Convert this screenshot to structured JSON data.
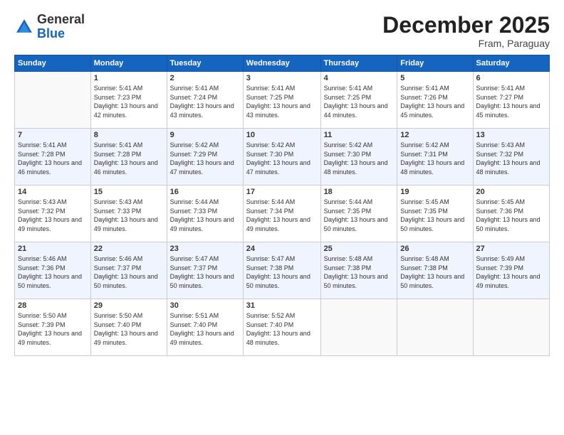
{
  "logo": {
    "general": "General",
    "blue": "Blue"
  },
  "title": "December 2025",
  "location": "Fram, Paraguay",
  "days_header": [
    "Sunday",
    "Monday",
    "Tuesday",
    "Wednesday",
    "Thursday",
    "Friday",
    "Saturday"
  ],
  "weeks": [
    [
      {
        "num": "",
        "sunrise": "",
        "sunset": "",
        "daylight": ""
      },
      {
        "num": "1",
        "sunrise": "Sunrise: 5:41 AM",
        "sunset": "Sunset: 7:23 PM",
        "daylight": "Daylight: 13 hours and 42 minutes."
      },
      {
        "num": "2",
        "sunrise": "Sunrise: 5:41 AM",
        "sunset": "Sunset: 7:24 PM",
        "daylight": "Daylight: 13 hours and 43 minutes."
      },
      {
        "num": "3",
        "sunrise": "Sunrise: 5:41 AM",
        "sunset": "Sunset: 7:25 PM",
        "daylight": "Daylight: 13 hours and 43 minutes."
      },
      {
        "num": "4",
        "sunrise": "Sunrise: 5:41 AM",
        "sunset": "Sunset: 7:25 PM",
        "daylight": "Daylight: 13 hours and 44 minutes."
      },
      {
        "num": "5",
        "sunrise": "Sunrise: 5:41 AM",
        "sunset": "Sunset: 7:26 PM",
        "daylight": "Daylight: 13 hours and 45 minutes."
      },
      {
        "num": "6",
        "sunrise": "Sunrise: 5:41 AM",
        "sunset": "Sunset: 7:27 PM",
        "daylight": "Daylight: 13 hours and 45 minutes."
      }
    ],
    [
      {
        "num": "7",
        "sunrise": "Sunrise: 5:41 AM",
        "sunset": "Sunset: 7:28 PM",
        "daylight": "Daylight: 13 hours and 46 minutes."
      },
      {
        "num": "8",
        "sunrise": "Sunrise: 5:41 AM",
        "sunset": "Sunset: 7:28 PM",
        "daylight": "Daylight: 13 hours and 46 minutes."
      },
      {
        "num": "9",
        "sunrise": "Sunrise: 5:42 AM",
        "sunset": "Sunset: 7:29 PM",
        "daylight": "Daylight: 13 hours and 47 minutes."
      },
      {
        "num": "10",
        "sunrise": "Sunrise: 5:42 AM",
        "sunset": "Sunset: 7:30 PM",
        "daylight": "Daylight: 13 hours and 47 minutes."
      },
      {
        "num": "11",
        "sunrise": "Sunrise: 5:42 AM",
        "sunset": "Sunset: 7:30 PM",
        "daylight": "Daylight: 13 hours and 48 minutes."
      },
      {
        "num": "12",
        "sunrise": "Sunrise: 5:42 AM",
        "sunset": "Sunset: 7:31 PM",
        "daylight": "Daylight: 13 hours and 48 minutes."
      },
      {
        "num": "13",
        "sunrise": "Sunrise: 5:43 AM",
        "sunset": "Sunset: 7:32 PM",
        "daylight": "Daylight: 13 hours and 48 minutes."
      }
    ],
    [
      {
        "num": "14",
        "sunrise": "Sunrise: 5:43 AM",
        "sunset": "Sunset: 7:32 PM",
        "daylight": "Daylight: 13 hours and 49 minutes."
      },
      {
        "num": "15",
        "sunrise": "Sunrise: 5:43 AM",
        "sunset": "Sunset: 7:33 PM",
        "daylight": "Daylight: 13 hours and 49 minutes."
      },
      {
        "num": "16",
        "sunrise": "Sunrise: 5:44 AM",
        "sunset": "Sunset: 7:33 PM",
        "daylight": "Daylight: 13 hours and 49 minutes."
      },
      {
        "num": "17",
        "sunrise": "Sunrise: 5:44 AM",
        "sunset": "Sunset: 7:34 PM",
        "daylight": "Daylight: 13 hours and 49 minutes."
      },
      {
        "num": "18",
        "sunrise": "Sunrise: 5:44 AM",
        "sunset": "Sunset: 7:35 PM",
        "daylight": "Daylight: 13 hours and 50 minutes."
      },
      {
        "num": "19",
        "sunrise": "Sunrise: 5:45 AM",
        "sunset": "Sunset: 7:35 PM",
        "daylight": "Daylight: 13 hours and 50 minutes."
      },
      {
        "num": "20",
        "sunrise": "Sunrise: 5:45 AM",
        "sunset": "Sunset: 7:36 PM",
        "daylight": "Daylight: 13 hours and 50 minutes."
      }
    ],
    [
      {
        "num": "21",
        "sunrise": "Sunrise: 5:46 AM",
        "sunset": "Sunset: 7:36 PM",
        "daylight": "Daylight: 13 hours and 50 minutes."
      },
      {
        "num": "22",
        "sunrise": "Sunrise: 5:46 AM",
        "sunset": "Sunset: 7:37 PM",
        "daylight": "Daylight: 13 hours and 50 minutes."
      },
      {
        "num": "23",
        "sunrise": "Sunrise: 5:47 AM",
        "sunset": "Sunset: 7:37 PM",
        "daylight": "Daylight: 13 hours and 50 minutes."
      },
      {
        "num": "24",
        "sunrise": "Sunrise: 5:47 AM",
        "sunset": "Sunset: 7:38 PM",
        "daylight": "Daylight: 13 hours and 50 minutes."
      },
      {
        "num": "25",
        "sunrise": "Sunrise: 5:48 AM",
        "sunset": "Sunset: 7:38 PM",
        "daylight": "Daylight: 13 hours and 50 minutes."
      },
      {
        "num": "26",
        "sunrise": "Sunrise: 5:48 AM",
        "sunset": "Sunset: 7:38 PM",
        "daylight": "Daylight: 13 hours and 50 minutes."
      },
      {
        "num": "27",
        "sunrise": "Sunrise: 5:49 AM",
        "sunset": "Sunset: 7:39 PM",
        "daylight": "Daylight: 13 hours and 49 minutes."
      }
    ],
    [
      {
        "num": "28",
        "sunrise": "Sunrise: 5:50 AM",
        "sunset": "Sunset: 7:39 PM",
        "daylight": "Daylight: 13 hours and 49 minutes."
      },
      {
        "num": "29",
        "sunrise": "Sunrise: 5:50 AM",
        "sunset": "Sunset: 7:40 PM",
        "daylight": "Daylight: 13 hours and 49 minutes."
      },
      {
        "num": "30",
        "sunrise": "Sunrise: 5:51 AM",
        "sunset": "Sunset: 7:40 PM",
        "daylight": "Daylight: 13 hours and 49 minutes."
      },
      {
        "num": "31",
        "sunrise": "Sunrise: 5:52 AM",
        "sunset": "Sunset: 7:40 PM",
        "daylight": "Daylight: 13 hours and 48 minutes."
      },
      {
        "num": "",
        "sunrise": "",
        "sunset": "",
        "daylight": ""
      },
      {
        "num": "",
        "sunrise": "",
        "sunset": "",
        "daylight": ""
      },
      {
        "num": "",
        "sunrise": "",
        "sunset": "",
        "daylight": ""
      }
    ]
  ]
}
